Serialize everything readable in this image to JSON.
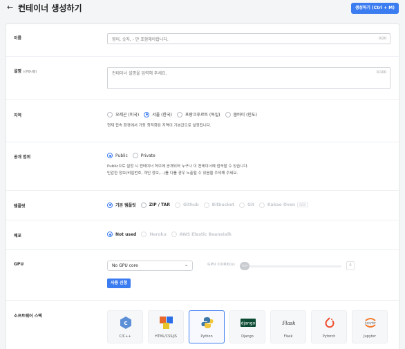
{
  "header": {
    "back_icon": "arrow-left-icon",
    "title": "컨테이너 생성하기",
    "create_button": "생성하기 (Ctrl + M)"
  },
  "form": {
    "name": {
      "label": "이름",
      "placeholder": "영어, 숫자, - 만 포함해야합니다.",
      "counter": "0/20"
    },
    "description": {
      "label": "설명",
      "label_note": "(선택사항)",
      "placeholder": "컨테이너 설명을 입력해 주세요.",
      "counter": "0/100"
    },
    "region": {
      "label": "지역",
      "options": [
        "오레곤 (미국)",
        "서울 (한국)",
        "프랑크푸르트 (독일)",
        "뭄바이 (인도)"
      ],
      "selected": "서울 (한국)",
      "help": "현재 접속 환경에서 가장 최적화된 지역이 기본값으로 설정됩니다."
    },
    "visibility": {
      "label": "공개 범위",
      "options": [
        "Public",
        "Private"
      ],
      "selected": "Public",
      "help_line1": "Public으로 설정 시 컨테이너 허브에 공개되어 누구나 이 컨테이너에 접속할 수 있습니다.",
      "help_line2": "민감한 정보(비밀번호, 개인 정보,...)를 다룰 경우 노출될 수 있음을 주의해 주세요."
    },
    "template": {
      "label": "템플릿",
      "options": [
        "기본 템플릿",
        "ZIP / TAR",
        "Github",
        "Bitbucket",
        "Git",
        "Kakao Oven"
      ],
      "selected": "기본 템플릿",
      "new_badge": "NEW"
    },
    "deploy": {
      "label": "배포",
      "options": [
        "Not used",
        "Heroku",
        "AWS Elastic Beanstalk"
      ],
      "selected": "Not used"
    },
    "gpu": {
      "label": "GPU",
      "select_value": "No GPU core",
      "count_label": "GPU CORE(s)",
      "count_value": "0",
      "apply_button": "사용 신청"
    },
    "stack": {
      "label": "소프트웨어 스택",
      "items": [
        {
          "name": "C/C++",
          "icon": "cpp-icon",
          "color": "#5b8fd6"
        },
        {
          "name": "HTML/CSS/JS",
          "icon": "html-css-js-icon",
          "color": "#e8692b"
        },
        {
          "name": "Python",
          "icon": "python-icon",
          "color": "#3b77a8"
        },
        {
          "name": "Django",
          "icon": "django-icon",
          "color": "#0c4b33"
        },
        {
          "name": "Flask",
          "icon": "flask-icon",
          "color": "#333333"
        },
        {
          "name": "Pytorch",
          "icon": "pytorch-icon",
          "color": "#ee4c2c"
        },
        {
          "name": "Jupyter",
          "icon": "jupyter-icon",
          "color": "#f37726"
        }
      ],
      "selected": "Python"
    }
  },
  "colors": {
    "accent": "#3b7cf0",
    "background": "#f4f5f7"
  }
}
